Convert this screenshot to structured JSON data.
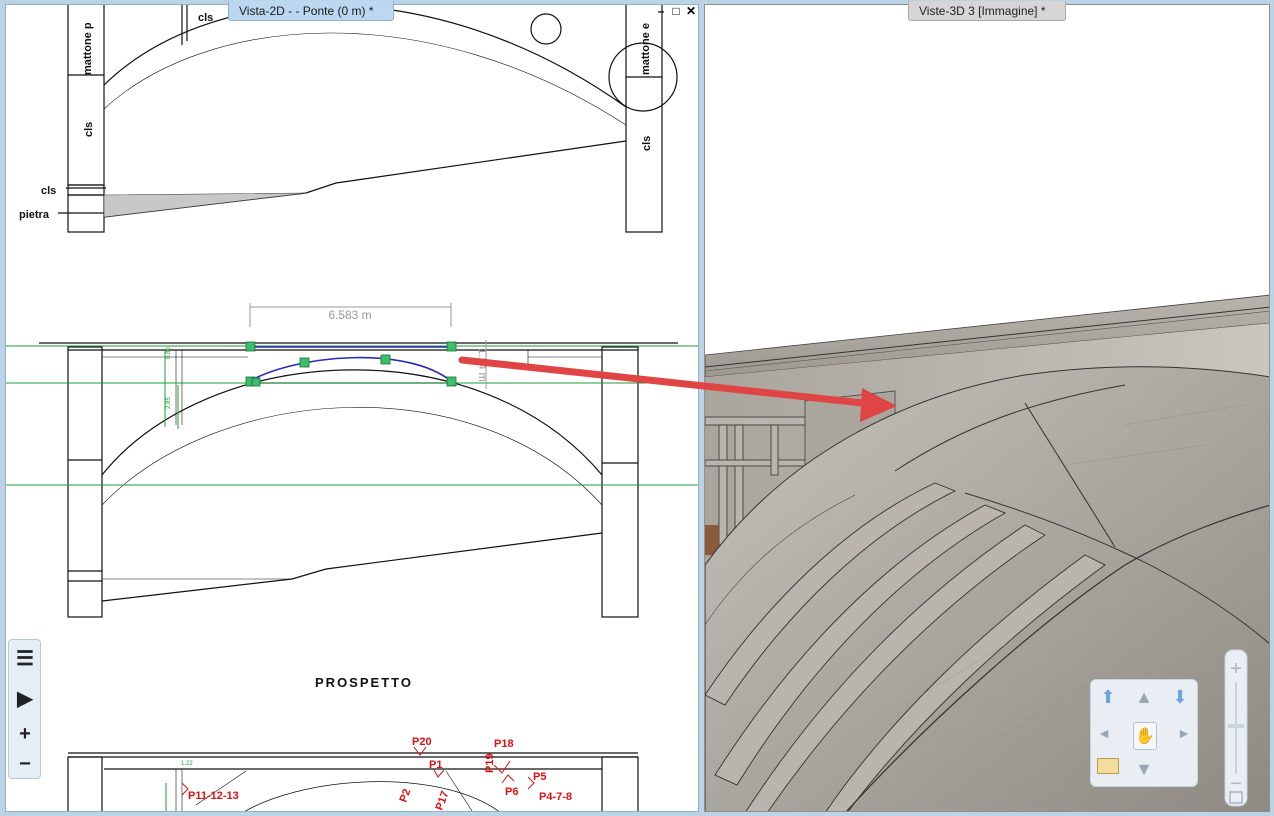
{
  "left_view": {
    "tab_title": "Vista-2D -  - Ponte (0 m) *",
    "buttons": {
      "minimize": "–",
      "restore": "□",
      "close": "✕"
    },
    "drawing": {
      "label_mattone_left": "mattone p",
      "label_mattone_right": "mattone e",
      "label_cls_top": "cls",
      "label_cls_left": "cls",
      "label_cls_right": "cls",
      "label_cls_base": "cls",
      "label_pietra": "pietra",
      "dimension_text": "6.583 m",
      "side_dim": "1.24 m",
      "section_title": "PROSPETTO",
      "small_dim_a": "1.22",
      "small_dim_b": "0.80",
      "small_dim_c": "2.85",
      "point_labels": {
        "p20": "P20",
        "p18": "P18",
        "p19": "P19",
        "p1": "P1",
        "p5": "P5",
        "p6": "P6",
        "p2": "P2",
        "p17": "P17",
        "p11": "P11-12-13",
        "p4": "P4-7-8"
      }
    },
    "toolbox": [
      "list-icon",
      "play-icon",
      "plus-icon",
      "minus-icon"
    ]
  },
  "right_view": {
    "tab_title": "Viste-3D 3 [Immagine] *",
    "nav_icons": [
      "up-left-arrow-icon",
      "up-arrow-icon",
      "up-right-arrow-icon",
      "left-arrow-icon",
      "hand-icon",
      "right-arrow-icon",
      "floor-plan-icon",
      "down-arrow-icon"
    ],
    "zoom_icons": [
      "zoom-in-icon",
      "zoom-out-icon",
      "fit-view-icon"
    ]
  },
  "colors": {
    "accent_arrow": "#e04545",
    "guide_line": "#1f9e3a",
    "selection_curve": "#2a2ab5",
    "handle": "#3dbf6a",
    "label_red": "#e01010"
  }
}
